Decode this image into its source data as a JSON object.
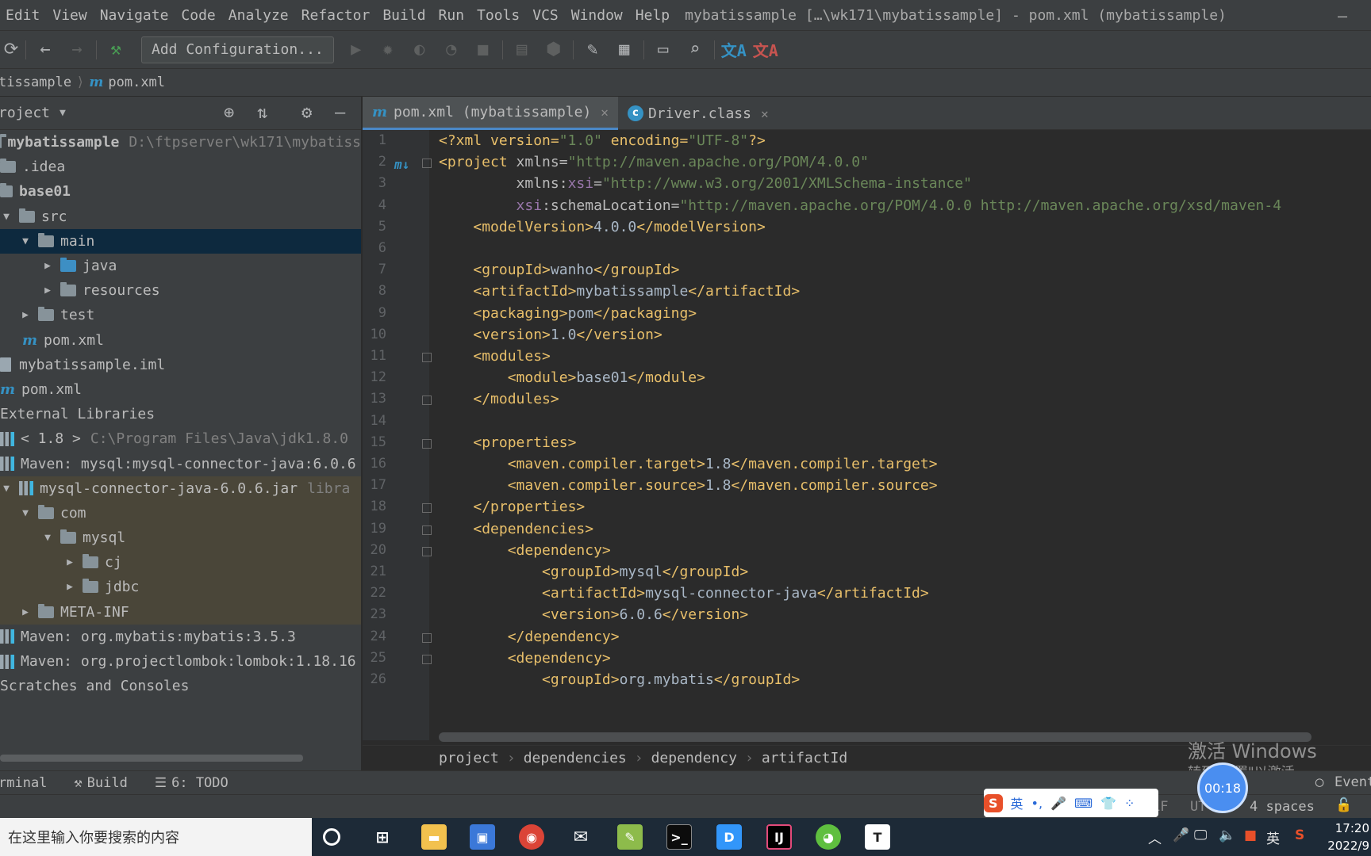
{
  "menu": [
    "Edit",
    "View",
    "Navigate",
    "Code",
    "Analyze",
    "Refactor",
    "Build",
    "Run",
    "Tools",
    "VCS",
    "Window",
    "Help"
  ],
  "window_title": "mybatissample […\\wk171\\mybatissample] - pom.xml (mybatissample)",
  "toolbar": {
    "add_configuration": "Add Configuration..."
  },
  "navbar": {
    "project": "tissample",
    "file": "pom.xml",
    "file_icon": "m"
  },
  "project_panel": {
    "title": "roject",
    "tree": [
      {
        "label": "mybatissample",
        "extra": "D:\\ftpserver\\wk171\\mybatiss",
        "indent": 0,
        "arrow": "",
        "icon": "module",
        "bold": true
      },
      {
        "label": ".idea",
        "extra": "",
        "indent": 0,
        "arrow": "",
        "icon": "folder"
      },
      {
        "label": "base01",
        "extra": "",
        "indent": 0,
        "arrow": "",
        "icon": "module",
        "bold": true
      },
      {
        "label": "src",
        "extra": "",
        "indent": 0,
        "arrow": "▼",
        "icon": "folder"
      },
      {
        "label": "main",
        "extra": "",
        "indent": 1,
        "arrow": "▼",
        "icon": "folder",
        "selected": true
      },
      {
        "label": "java",
        "extra": "",
        "indent": 2,
        "arrow": "▶",
        "icon": "folder-blue"
      },
      {
        "label": "resources",
        "extra": "",
        "indent": 2,
        "arrow": "▶",
        "icon": "folder"
      },
      {
        "label": "test",
        "extra": "",
        "indent": 1,
        "arrow": "▶",
        "icon": "folder"
      },
      {
        "label": "pom.xml",
        "extra": "",
        "indent": 1,
        "arrow": "",
        "icon": "maven"
      },
      {
        "label": "mybatissample.iml",
        "extra": "",
        "indent": 0,
        "arrow": "",
        "icon": "file"
      },
      {
        "label": "pom.xml",
        "extra": "",
        "indent": 0,
        "arrow": "",
        "icon": "maven"
      },
      {
        "label": "External Libraries",
        "extra": "",
        "indent": -1,
        "arrow": "",
        "icon": "none"
      },
      {
        "label": "< 1.8 >",
        "extra": "C:\\Program Files\\Java\\jdk1.8.0",
        "indent": 0,
        "arrow": "",
        "icon": "lib"
      },
      {
        "label": "Maven: mysql:mysql-connector-java:6.0.6",
        "extra": "",
        "indent": 0,
        "arrow": "",
        "icon": "lib"
      },
      {
        "label": "mysql-connector-java-6.0.6.jar",
        "extra": "libra",
        "indent": 0,
        "arrow": "▼",
        "icon": "jar",
        "lib": true
      },
      {
        "label": "com",
        "extra": "",
        "indent": 1,
        "arrow": "▼",
        "icon": "folder",
        "lib": true
      },
      {
        "label": "mysql",
        "extra": "",
        "indent": 2,
        "arrow": "▼",
        "icon": "folder",
        "lib": true
      },
      {
        "label": "cj",
        "extra": "",
        "indent": 3,
        "arrow": "▶",
        "icon": "folder",
        "lib": true
      },
      {
        "label": "jdbc",
        "extra": "",
        "indent": 3,
        "arrow": "▶",
        "icon": "folder",
        "lib": true
      },
      {
        "label": "META-INF",
        "extra": "",
        "indent": 1,
        "arrow": "▶",
        "icon": "folder",
        "lib": true
      },
      {
        "label": "Maven: org.mybatis:mybatis:3.5.3",
        "extra": "",
        "indent": 0,
        "arrow": "",
        "icon": "lib"
      },
      {
        "label": "Maven: org.projectlombok:lombok:1.18.16",
        "extra": "",
        "indent": 0,
        "arrow": "",
        "icon": "lib"
      },
      {
        "label": "Scratches and Consoles",
        "extra": "",
        "indent": -1,
        "arrow": "",
        "icon": "none"
      }
    ]
  },
  "tabs": [
    {
      "label": "pom.xml (mybatissample)",
      "icon": "m",
      "active": true
    },
    {
      "label": "Driver.class",
      "icon": "c",
      "active": false
    }
  ],
  "code_lines": [
    [
      [
        "tag",
        "<?xml version="
      ],
      [
        "str",
        "\"1.0\""
      ],
      [
        "tag",
        " encoding="
      ],
      [
        "str",
        "\"UTF-8\""
      ],
      [
        "tag",
        "?>"
      ]
    ],
    [
      [
        "tag",
        "<project "
      ],
      [
        "attr",
        "xmlns="
      ],
      [
        "str",
        "\"http://maven.apache.org/POM/4.0.0\""
      ]
    ],
    [
      [
        "txt",
        "         "
      ],
      [
        "attr",
        "xmlns:"
      ],
      [
        "ns",
        "xsi"
      ],
      [
        "attr",
        "="
      ],
      [
        "str",
        "\"http://www.w3.org/2001/XMLSchema-instance\""
      ]
    ],
    [
      [
        "txt",
        "         "
      ],
      [
        "ns",
        "xsi"
      ],
      [
        "attr",
        ":schemaLocation="
      ],
      [
        "str",
        "\"http://maven.apache.org/POM/4.0.0 http://maven.apache.org/xsd/maven-4"
      ]
    ],
    [
      [
        "txt",
        "    "
      ],
      [
        "tag",
        "<modelVersion>"
      ],
      [
        "txt",
        "4.0.0"
      ],
      [
        "tag",
        "</modelVersion>"
      ]
    ],
    [],
    [
      [
        "txt",
        "    "
      ],
      [
        "tag",
        "<groupId>"
      ],
      [
        "txt",
        "wanho"
      ],
      [
        "tag",
        "</groupId>"
      ]
    ],
    [
      [
        "txt",
        "    "
      ],
      [
        "tag",
        "<artifactId>"
      ],
      [
        "txt",
        "mybatissample"
      ],
      [
        "tag",
        "</artifactId>"
      ]
    ],
    [
      [
        "txt",
        "    "
      ],
      [
        "tag",
        "<packaging>"
      ],
      [
        "txt",
        "pom"
      ],
      [
        "tag",
        "</packaging>"
      ]
    ],
    [
      [
        "txt",
        "    "
      ],
      [
        "tag",
        "<version>"
      ],
      [
        "txt",
        "1.0"
      ],
      [
        "tag",
        "</version>"
      ]
    ],
    [
      [
        "txt",
        "    "
      ],
      [
        "tag",
        "<modules>"
      ]
    ],
    [
      [
        "txt",
        "        "
      ],
      [
        "tag",
        "<module>"
      ],
      [
        "txt",
        "base01"
      ],
      [
        "tag",
        "</module>"
      ]
    ],
    [
      [
        "txt",
        "    "
      ],
      [
        "tag",
        "</modules>"
      ]
    ],
    [],
    [
      [
        "txt",
        "    "
      ],
      [
        "tag",
        "<properties>"
      ]
    ],
    [
      [
        "txt",
        "        "
      ],
      [
        "tag",
        "<maven.compiler.target>"
      ],
      [
        "txt",
        "1.8"
      ],
      [
        "tag",
        "</maven.compiler.target>"
      ]
    ],
    [
      [
        "txt",
        "        "
      ],
      [
        "tag",
        "<maven.compiler.source>"
      ],
      [
        "txt",
        "1.8"
      ],
      [
        "tag",
        "</maven.compiler.source>"
      ]
    ],
    [
      [
        "txt",
        "    "
      ],
      [
        "tag",
        "</properties>"
      ]
    ],
    [
      [
        "txt",
        "    "
      ],
      [
        "tag",
        "<dependencies>"
      ]
    ],
    [
      [
        "txt",
        "        "
      ],
      [
        "tag",
        "<dependency>"
      ]
    ],
    [
      [
        "txt",
        "            "
      ],
      [
        "tag",
        "<groupId>"
      ],
      [
        "txt",
        "mysql"
      ],
      [
        "tag",
        "</groupId>"
      ]
    ],
    [
      [
        "txt",
        "            "
      ],
      [
        "tag",
        "<artifactId>"
      ],
      [
        "txt",
        "mysql-connector-java"
      ],
      [
        "tag",
        "</artifactId>"
      ]
    ],
    [
      [
        "txt",
        "            "
      ],
      [
        "tag",
        "<version>"
      ],
      [
        "txt",
        "6.0.6"
      ],
      [
        "tag",
        "</version>"
      ]
    ],
    [
      [
        "txt",
        "        "
      ],
      [
        "tag",
        "</dependency>"
      ]
    ],
    [
      [
        "txt",
        "        "
      ],
      [
        "tag",
        "<dependency>"
      ]
    ],
    [
      [
        "txt",
        "            "
      ],
      [
        "tag",
        "<groupId>"
      ],
      [
        "txt",
        "org.mybatis"
      ],
      [
        "tag",
        "</groupId>"
      ]
    ]
  ],
  "fold_lines": [
    2,
    11,
    13,
    15,
    18,
    19,
    20,
    24,
    25
  ],
  "breadcrumbs": [
    "project",
    "dependencies",
    "dependency",
    "artifactId"
  ],
  "bottom_tools": [
    {
      "label": "rminal",
      "icon": ""
    },
    {
      "label": "Build",
      "icon": "hammer-icon"
    },
    {
      "label": "6: TODO",
      "icon": "list-icon"
    }
  ],
  "event_log": "Event",
  "status": {
    "lf": "LF",
    "encoding": "UT",
    "indent": "4 spaces"
  },
  "watermark": {
    "line1": "激活 Windows",
    "line2": "转到\"设置\"以激活 Windows。"
  },
  "timer": "00:18",
  "ime": {
    "lang": "英"
  },
  "taskbar": {
    "search_placeholder": "在这里输入你要搜索的内容",
    "tray_lang": "英",
    "time": "17:20",
    "date": "2022/9"
  }
}
